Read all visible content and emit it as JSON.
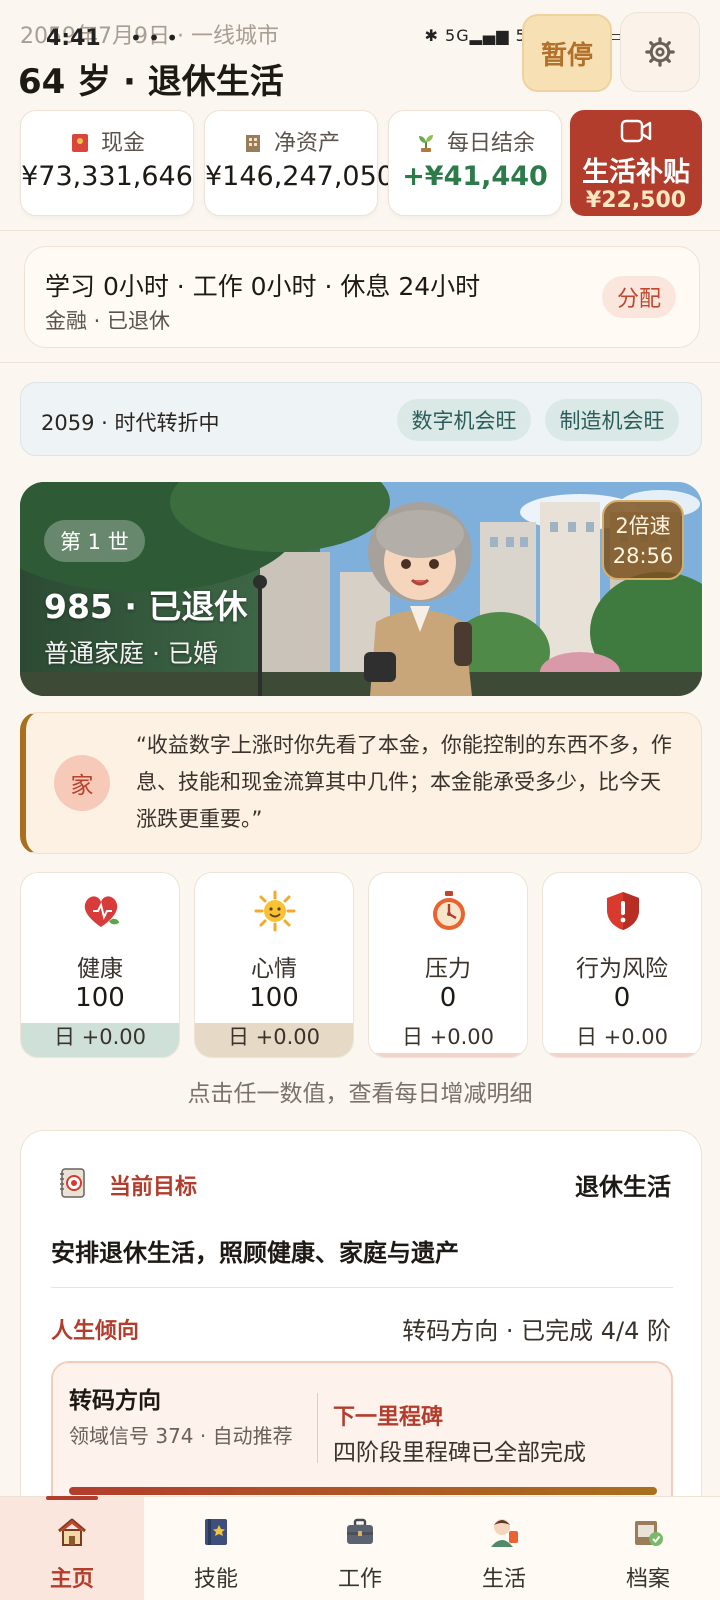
{
  "status_bar": {
    "time": "4:41",
    "dots": "• • •",
    "right": "✱ 5G▂▄▆ 5G▂▄▆ ◠ ▭ 61%"
  },
  "header": {
    "date_city": "2059年7月9日 · 一线城市",
    "age_status": "64 岁 · 退休生活",
    "pause_label": "暂停",
    "settings_icon": "gear-icon"
  },
  "stats": [
    {
      "label": "现金",
      "value": "¥73,331,646",
      "icon": "red-envelope-icon"
    },
    {
      "label": "净资产",
      "value": "¥146,247,050",
      "icon": "building-icon"
    },
    {
      "label": "每日结余",
      "value": "+¥41,440",
      "icon": "sprout-icon"
    }
  ],
  "subsidy": {
    "title": "生活补贴",
    "amount": "¥22,500",
    "icon": "video-icon"
  },
  "schedule": {
    "line1": "学习 0小时 · 工作 0小时 · 休息 24小时",
    "line2": "金融 · 已退休",
    "assign_label": "分配"
  },
  "era": {
    "text": "2059 · 时代转折中",
    "chips": [
      "数字机会旺",
      "制造机会旺"
    ]
  },
  "hero": {
    "life_badge": "第 1 世",
    "title": "985 · 已退休",
    "subtitle": "普通家庭 · 已婚",
    "speed_line1": "2倍速",
    "speed_line2": "28:56"
  },
  "quote": {
    "badge": "家",
    "text": "“收益数字上涨时你先看了本金，你能控制的东西不多，作息、技能和现金流算其中几件；本金能承受多少，比今天涨跌更重要。”"
  },
  "meters": [
    {
      "label": "健康",
      "value": "100",
      "daily": "日 +0.00",
      "icon": "heart-icon",
      "fill_color": "#cfe0d8",
      "level": 1.0
    },
    {
      "label": "心情",
      "value": "100",
      "daily": "日 +0.00",
      "icon": "sun-icon",
      "fill_color": "#e6d9c6",
      "level": 1.0
    },
    {
      "label": "压力",
      "value": "0",
      "daily": "日 +0.00",
      "icon": "stopwatch-icon",
      "fill_color": "#f3d4cb",
      "level": 0.0
    },
    {
      "label": "行为风险",
      "value": "0",
      "daily": "日 +0.00",
      "icon": "shield-alert-icon",
      "fill_color": "#f3d4cb",
      "level": 0.0
    }
  ],
  "hint": "点击任一数值，查看每日增减明细",
  "goal": {
    "label": "当前目标",
    "status": "退休生活",
    "description": "安排退休生活，照顾健康、家庭与遗产",
    "tendency_label": "人生倾向",
    "tendency_value": "转码方向 · 已完成 4/4 阶",
    "card_title": "转码方向",
    "card_sub": "领域信号 374 · 自动推荐",
    "next_label": "下一里程碑",
    "next_value": "四阶段里程碑已全部完成",
    "progress": 1.0
  },
  "nav": [
    {
      "label": "主页",
      "icon": "home-icon",
      "active": true
    },
    {
      "label": "技能",
      "icon": "skill-book-icon",
      "active": false
    },
    {
      "label": "工作",
      "icon": "briefcase-icon",
      "active": false
    },
    {
      "label": "生活",
      "icon": "life-person-icon",
      "active": false
    },
    {
      "label": "档案",
      "icon": "archive-icon",
      "active": false
    }
  ]
}
